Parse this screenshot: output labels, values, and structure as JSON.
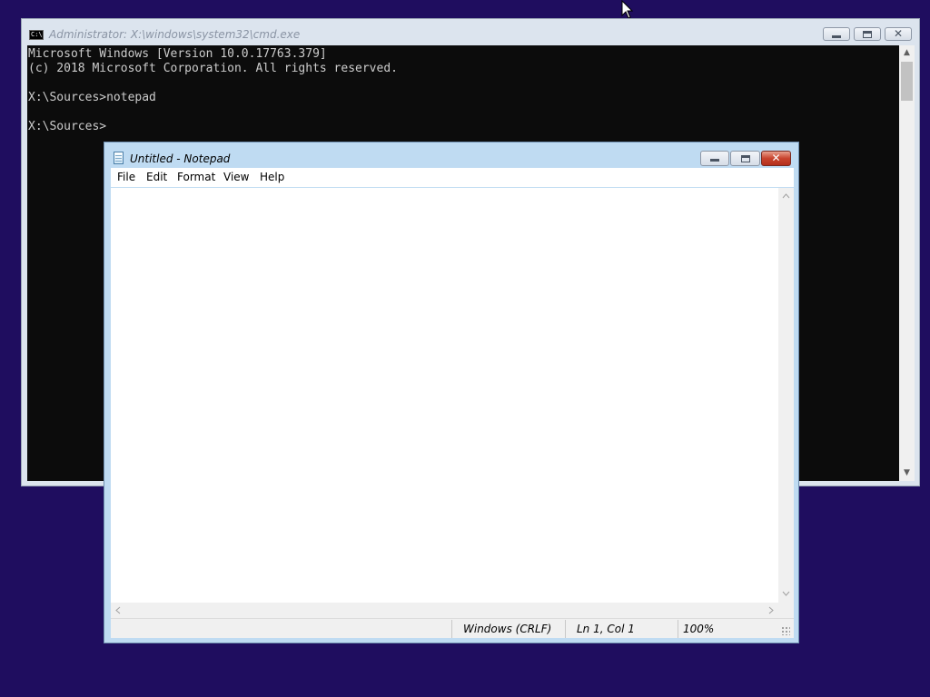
{
  "desktop": {
    "background": "#1f0d5f"
  },
  "cmd": {
    "icon_text": "C:\\",
    "title": "Administrator: X:\\windows\\system32\\cmd.exe",
    "lines": [
      "Microsoft Windows [Version 10.0.17763.379]",
      "(c) 2018 Microsoft Corporation. All rights reserved.",
      "",
      "X:\\Sources>notepad",
      "",
      "X:\\Sources>"
    ],
    "controls": {
      "minimize": "minimize-icon",
      "maximize": "maximize-icon",
      "close": "close-icon"
    }
  },
  "notepad": {
    "title": "Untitled - Notepad",
    "menu": [
      "File",
      "Edit",
      "Format",
      "View",
      "Help"
    ],
    "content": "",
    "status": {
      "line_ending": "Windows (CRLF)",
      "position": "Ln 1, Col 1",
      "zoom": "100%"
    },
    "close_color": "#c8442e"
  },
  "icons": {
    "cursor": "mouse-pointer-icon",
    "scroll_up": "chevron-up-icon",
    "scroll_down": "chevron-down-icon",
    "scroll_left": "chevron-left-icon",
    "scroll_right": "chevron-right-icon",
    "resize": "resize-grip-icon"
  }
}
